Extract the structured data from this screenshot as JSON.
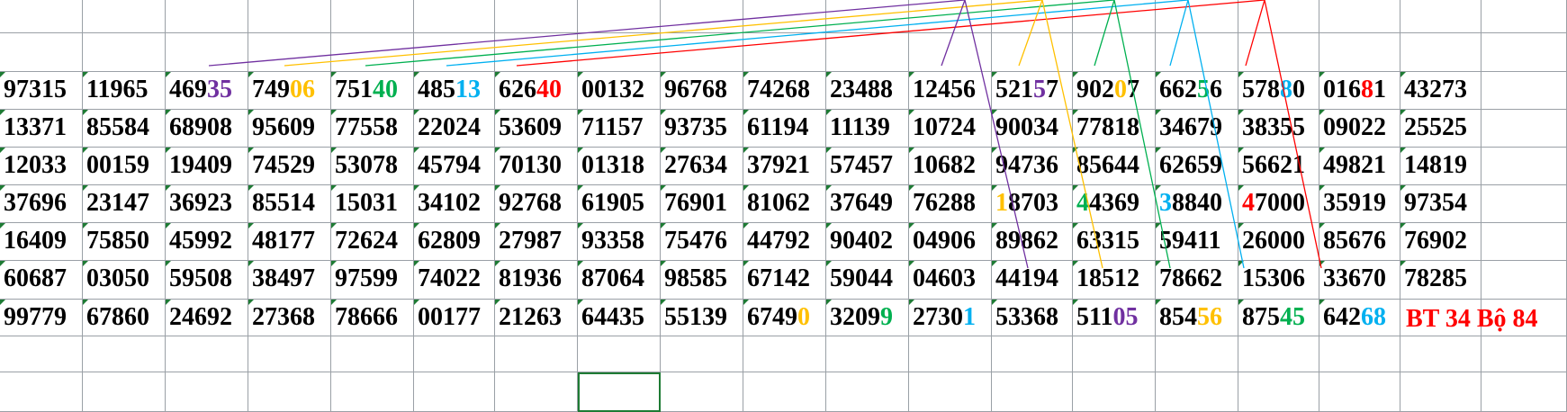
{
  "sheet": {
    "rows": [
      [
        [
          {
            "t": "97315"
          }
        ],
        [
          {
            "t": "11965"
          }
        ],
        [
          {
            "t": "469"
          },
          {
            "t": "35",
            "c": "purple"
          }
        ],
        [
          {
            "t": "749"
          },
          {
            "t": "06",
            "c": "orange"
          }
        ],
        [
          {
            "t": "751"
          },
          {
            "t": "40",
            "c": "green"
          }
        ],
        [
          {
            "t": "485"
          },
          {
            "t": "13",
            "c": "blue"
          }
        ],
        [
          {
            "t": "626"
          },
          {
            "t": "40",
            "c": "red"
          }
        ],
        [
          {
            "t": "00132"
          }
        ],
        [
          {
            "t": "96768"
          }
        ],
        [
          {
            "t": "74268"
          }
        ],
        [
          {
            "t": "23488"
          }
        ],
        [
          {
            "t": "12456"
          }
        ],
        [
          {
            "t": "521"
          },
          {
            "t": "5",
            "c": "purple"
          },
          {
            "t": "7"
          }
        ],
        [
          {
            "t": "902"
          },
          {
            "t": "0",
            "c": "orange"
          },
          {
            "t": "7"
          }
        ],
        [
          {
            "t": "662"
          },
          {
            "t": "5",
            "c": "green"
          },
          {
            "t": "6"
          }
        ],
        [
          {
            "t": "578"
          },
          {
            "t": "8",
            "c": "blue"
          },
          {
            "t": "0"
          }
        ],
        [
          {
            "t": "016"
          },
          {
            "t": "8",
            "c": "red"
          },
          {
            "t": "1"
          }
        ],
        [
          {
            "t": "43273"
          }
        ]
      ],
      [
        [
          {
            "t": "13371"
          }
        ],
        [
          {
            "t": "85584"
          }
        ],
        [
          {
            "t": "68908"
          }
        ],
        [
          {
            "t": "95609"
          }
        ],
        [
          {
            "t": "77558"
          }
        ],
        [
          {
            "t": "22024"
          }
        ],
        [
          {
            "t": "53609"
          }
        ],
        [
          {
            "t": "71157"
          }
        ],
        [
          {
            "t": "93735"
          }
        ],
        [
          {
            "t": "61194"
          }
        ],
        [
          {
            "t": "11139"
          }
        ],
        [
          {
            "t": "10724"
          }
        ],
        [
          {
            "t": "90034"
          }
        ],
        [
          {
            "t": "77818"
          }
        ],
        [
          {
            "t": "34679"
          }
        ],
        [
          {
            "t": "38355"
          }
        ],
        [
          {
            "t": "09022"
          }
        ],
        [
          {
            "t": "25525"
          }
        ]
      ],
      [
        [
          {
            "t": "12033"
          }
        ],
        [
          {
            "t": "00159"
          }
        ],
        [
          {
            "t": "19409"
          }
        ],
        [
          {
            "t": "74529"
          }
        ],
        [
          {
            "t": "53078"
          }
        ],
        [
          {
            "t": "45794"
          }
        ],
        [
          {
            "t": "70130"
          }
        ],
        [
          {
            "t": "01318"
          }
        ],
        [
          {
            "t": "27634"
          }
        ],
        [
          {
            "t": "37921"
          }
        ],
        [
          {
            "t": "57457"
          }
        ],
        [
          {
            "t": "10682"
          }
        ],
        [
          {
            "t": "94736"
          }
        ],
        [
          {
            "t": "85644"
          }
        ],
        [
          {
            "t": "62659"
          }
        ],
        [
          {
            "t": "56621"
          }
        ],
        [
          {
            "t": "49821"
          }
        ],
        [
          {
            "t": "14819"
          }
        ]
      ],
      [
        [
          {
            "t": "37696"
          }
        ],
        [
          {
            "t": "23147"
          }
        ],
        [
          {
            "t": "36923"
          }
        ],
        [
          {
            "t": "85514"
          }
        ],
        [
          {
            "t": "15031"
          }
        ],
        [
          {
            "t": "34102"
          }
        ],
        [
          {
            "t": "92768"
          }
        ],
        [
          {
            "t": "61905"
          }
        ],
        [
          {
            "t": "76901"
          }
        ],
        [
          {
            "t": "81062"
          }
        ],
        [
          {
            "t": "37649"
          }
        ],
        [
          {
            "t": "76288"
          }
        ],
        [
          {
            "t": "1",
            "c": "orange"
          },
          {
            "t": "8703"
          }
        ],
        [
          {
            "t": "4",
            "c": "green"
          },
          {
            "t": "4369"
          }
        ],
        [
          {
            "t": "3",
            "c": "blue"
          },
          {
            "t": "8840"
          }
        ],
        [
          {
            "t": "4",
            "c": "red"
          },
          {
            "t": "7000"
          }
        ],
        [
          {
            "t": "35919"
          }
        ],
        [
          {
            "t": "97354"
          }
        ]
      ],
      [
        [
          {
            "t": "16409"
          }
        ],
        [
          {
            "t": "75850"
          }
        ],
        [
          {
            "t": "45992"
          }
        ],
        [
          {
            "t": "48177"
          }
        ],
        [
          {
            "t": "72624"
          }
        ],
        [
          {
            "t": "62809"
          }
        ],
        [
          {
            "t": "27987"
          }
        ],
        [
          {
            "t": "93358"
          }
        ],
        [
          {
            "t": "75476"
          }
        ],
        [
          {
            "t": "44792"
          }
        ],
        [
          {
            "t": "90402"
          }
        ],
        [
          {
            "t": "04906"
          }
        ],
        [
          {
            "t": "89862"
          }
        ],
        [
          {
            "t": "63315"
          }
        ],
        [
          {
            "t": "59411"
          }
        ],
        [
          {
            "t": "26000"
          }
        ],
        [
          {
            "t": "85676"
          }
        ],
        [
          {
            "t": "76902"
          }
        ]
      ],
      [
        [
          {
            "t": "60687"
          }
        ],
        [
          {
            "t": "03050"
          }
        ],
        [
          {
            "t": "59508"
          }
        ],
        [
          {
            "t": "38497"
          }
        ],
        [
          {
            "t": "97599"
          }
        ],
        [
          {
            "t": "74022"
          }
        ],
        [
          {
            "t": "81936"
          }
        ],
        [
          {
            "t": "87064"
          }
        ],
        [
          {
            "t": "98585"
          }
        ],
        [
          {
            "t": "67142"
          }
        ],
        [
          {
            "t": "59044"
          }
        ],
        [
          {
            "t": "04603"
          }
        ],
        [
          {
            "t": "44194"
          }
        ],
        [
          {
            "t": "18512"
          }
        ],
        [
          {
            "t": "78662"
          }
        ],
        [
          {
            "t": "15306"
          }
        ],
        [
          {
            "t": "33670"
          }
        ],
        [
          {
            "t": "78285"
          }
        ]
      ],
      [
        [
          {
            "t": "99779"
          }
        ],
        [
          {
            "t": "67860"
          }
        ],
        [
          {
            "t": "24692"
          }
        ],
        [
          {
            "t": "27368"
          }
        ],
        [
          {
            "t": "78666"
          }
        ],
        [
          {
            "t": "00177"
          }
        ],
        [
          {
            "t": "21263"
          }
        ],
        [
          {
            "t": "64435"
          }
        ],
        [
          {
            "t": "55139"
          }
        ],
        [
          {
            "t": "6749"
          },
          {
            "t": "0",
            "c": "orange"
          }
        ],
        [
          {
            "t": "3209"
          },
          {
            "t": "9",
            "c": "green"
          }
        ],
        [
          {
            "t": "2730"
          },
          {
            "t": "1",
            "c": "blue"
          }
        ],
        [
          {
            "t": "53368"
          }
        ],
        [
          {
            "t": "511"
          },
          {
            "t": "05",
            "c": "purple"
          }
        ],
        [
          {
            "t": "854"
          },
          {
            "t": "56",
            "c": "orange"
          }
        ],
        [
          {
            "t": "875"
          },
          {
            "t": "45",
            "c": "green"
          }
        ],
        [
          {
            "t": "642"
          },
          {
            "t": "68",
            "c": "blue"
          }
        ]
      ]
    ],
    "note": "BT 34 Bộ 84"
  },
  "colors": {
    "purple": "#7030a0",
    "orange": "#ffc000",
    "green": "#00b050",
    "blue": "#00b0f0",
    "red": "#ff0000",
    "grid": "#9aa0a6",
    "selection": "#1e7b34"
  }
}
